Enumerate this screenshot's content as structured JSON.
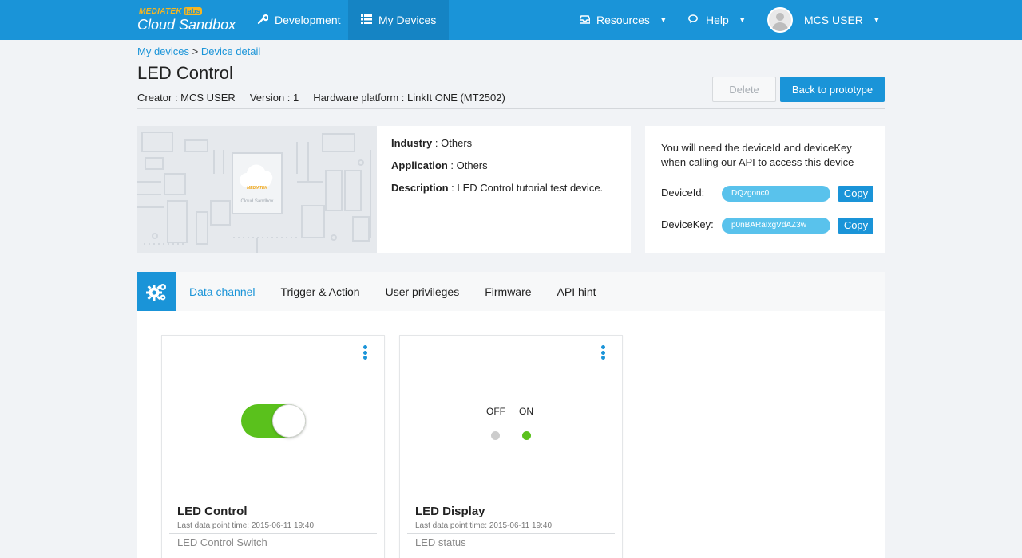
{
  "nav": {
    "logo_brand": "MEDIATEK",
    "logo_labs": "labs",
    "logo_product": "Cloud Sandbox",
    "development": "Development",
    "my_devices": "My Devices",
    "resources": "Resources",
    "help": "Help",
    "user": "MCS USER"
  },
  "breadcrumb": {
    "my_devices": "My devices",
    "separator": ">",
    "device_detail": "Device detail"
  },
  "device": {
    "title": "LED Control",
    "creator": "Creator : MCS USER",
    "version": "Version : 1",
    "platform": "Hardware platform : LinkIt ONE (MT2502)",
    "image_brand": "MEDIATEK",
    "image_caption": "Cloud Sandbox"
  },
  "actions": {
    "delete": "Delete",
    "back": "Back to prototype"
  },
  "info": {
    "industry_label": "Industry",
    "industry_value": " : Others",
    "application_label": "Application",
    "application_value": " : Others",
    "description_label": "Description",
    "description_value": " : LED Control tutorial test device."
  },
  "keys": {
    "note": "You will need the deviceId and deviceKey when calling our API to access this device",
    "device_id_label": "DeviceId:",
    "device_id": "DQzgonc0",
    "device_key_label": "DeviceKey:",
    "device_key": "p0nBARaIxgVdAZ3w",
    "copy": "Copy"
  },
  "tabs": [
    {
      "label": "Data channel",
      "active": true
    },
    {
      "label": "Trigger & Action",
      "active": false
    },
    {
      "label": "User privileges",
      "active": false
    },
    {
      "label": "Firmware",
      "active": false
    },
    {
      "label": "API hint",
      "active": false
    }
  ],
  "channels": [
    {
      "name": "LED Control",
      "time": "Last data point time: 2015-06-11 19:40",
      "description": "LED Control Switch",
      "state": "on"
    },
    {
      "name": "LED Display",
      "time": "Last data point time: 2015-06-11 19:40",
      "description": "LED status",
      "off_label": "OFF",
      "on_label": "ON",
      "state": "on"
    }
  ],
  "colors": {
    "primary": "#1a94d8",
    "on_green": "#5ac11c",
    "off_grey": "#cccccc",
    "key_pill": "#59c2ec"
  },
  "icons": {
    "development": "wrench-icon",
    "my_devices": "list-icon",
    "resources": "inbox-icon",
    "help": "chat-icon",
    "data_channel_tab": "gears-icon",
    "image_logo": "cloud-icon"
  }
}
